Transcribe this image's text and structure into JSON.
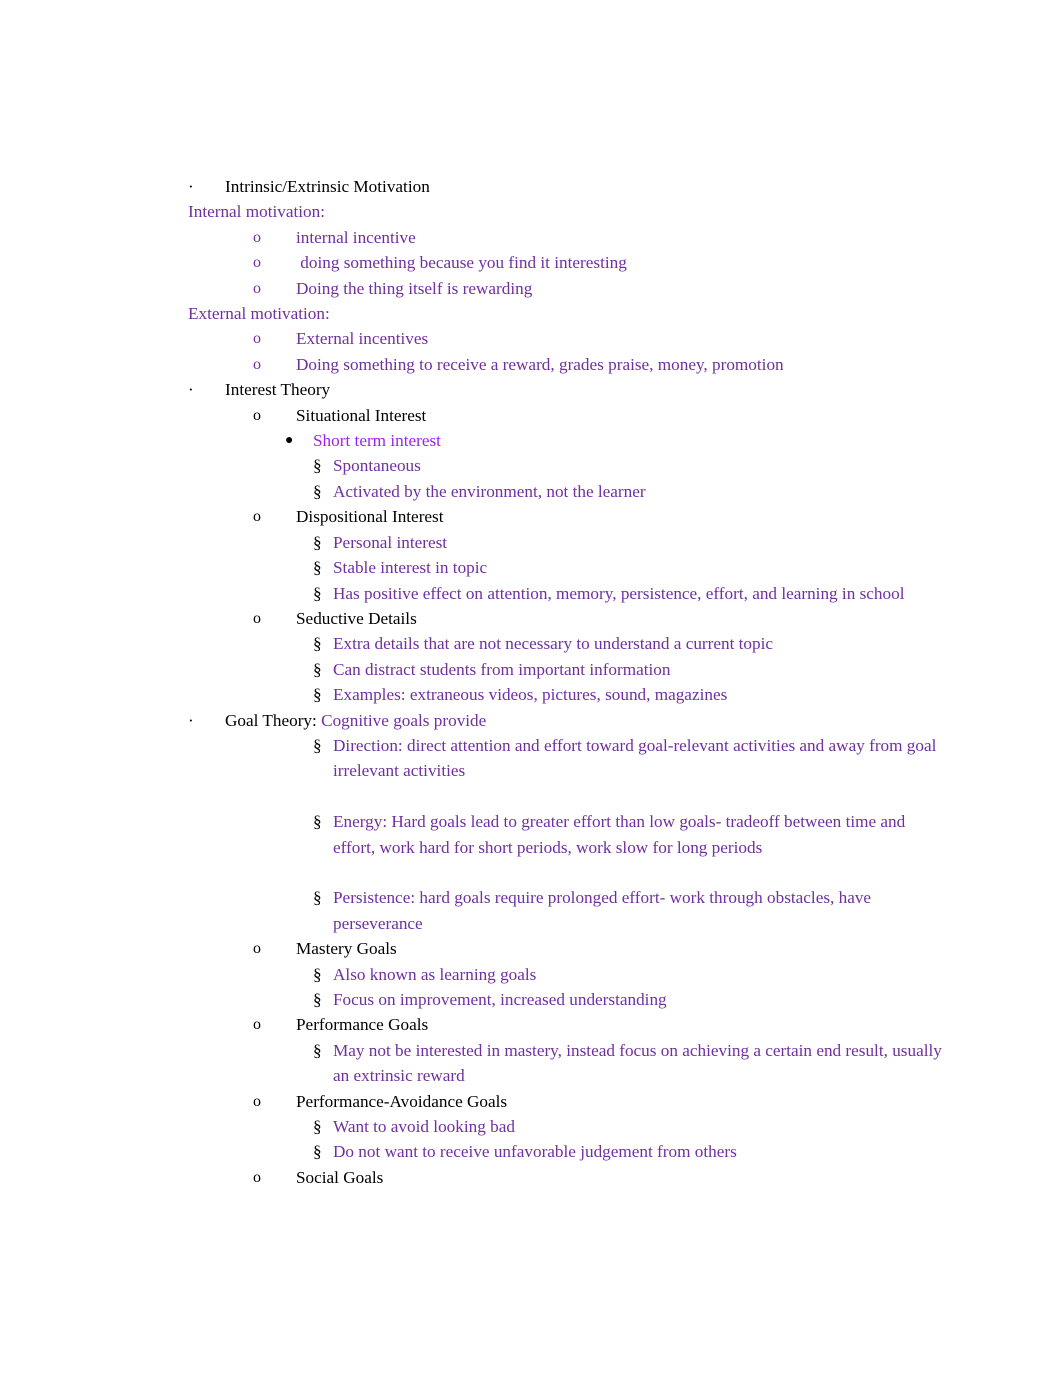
{
  "document": {
    "colors": {
      "body_purple": "#7030A0",
      "accent_purple": "#A020F0",
      "text_black": "#000000",
      "page_background": "#ffffff"
    },
    "markers": {
      "level1": "·",
      "level2": "o",
      "level3": "●",
      "level4": "§"
    },
    "sections": [
      {
        "heading": "Intrinsic/Extrinsic Motivation",
        "subheading_internal": "Internal motivation:",
        "internal_items": [
          "internal incentive",
          " doing something because you find it interesting",
          "Doing the thing itself is rewarding"
        ],
        "subheading_external": "External motivation:",
        "external_items": [
          "External incentives",
          "Doing something to receive a reward, grades praise, money, promotion"
        ]
      },
      {
        "heading": "Interest Theory",
        "groups": [
          {
            "title": "Situational Interest",
            "bullet": "Short term interest",
            "items": [
              "Spontaneous",
              "Activated by the environment, not the learner"
            ]
          },
          {
            "title": "Dispositional Interest",
            "items": [
              "Personal interest",
              "Stable interest in topic",
              "Has positive effect on attention, memory, persistence, effort, and learning in school"
            ]
          },
          {
            "title": "Seductive Details",
            "items": [
              "Extra details that are not necessary to understand a current topic",
              "Can distract students from important information",
              "Examples: extraneous videos, pictures, sound, magazines"
            ]
          }
        ]
      },
      {
        "heading_black": "Goal Theory:",
        "heading_purple": "Cognitive goals provide",
        "cognitive_items": [
          "Direction: direct attention and effort toward goal-relevant activities and away from goal irrelevant activities",
          "Energy: Hard goals lead to greater effort than low goals- tradeoff between time and effort, work hard for short periods, work slow for long periods",
          "Persistence: hard goals require prolonged effort- work through obstacles, have perseverance"
        ],
        "groups": [
          {
            "title": "Mastery Goals",
            "items": [
              "Also known as learning goals",
              "Focus on improvement, increased understanding"
            ]
          },
          {
            "title": "Performance Goals",
            "items": [
              "May not be interested in mastery, instead focus on achieving a certain end result, usually an extrinsic reward"
            ]
          },
          {
            "title": "Performance-Avoidance Goals",
            "items": [
              "Want to avoid looking bad",
              "Do not want to receive unfavorable judgement from others"
            ]
          },
          {
            "title": "Social Goals",
            "items": []
          }
        ]
      }
    ]
  }
}
